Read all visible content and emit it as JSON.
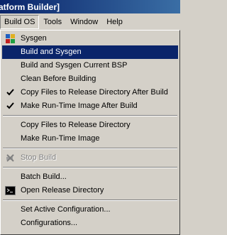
{
  "window": {
    "title_fragment": "atform Builder]"
  },
  "menubar": {
    "items": [
      {
        "label": "Build OS",
        "open": true
      },
      {
        "label": "Tools"
      },
      {
        "label": "Window"
      },
      {
        "label": "Help"
      }
    ]
  },
  "menu": {
    "sysgen": "Sysgen",
    "build_and_sysgen": "Build and Sysgen",
    "build_and_sysgen_bsp": "Build and Sysgen Current BSP",
    "clean_before_building": "Clean Before Building",
    "copy_files_after_build": "Copy Files to Release Directory After Build",
    "make_runtime_after_build": "Make Run-Time Image After Build",
    "copy_files_to_release": "Copy Files to Release Directory",
    "make_runtime_image": "Make Run-Time Image",
    "stop_build": "Stop Build",
    "batch_build": "Batch Build...",
    "open_release_dir": "Open Release Directory",
    "set_active_config": "Set Active Configuration...",
    "configurations": "Configurations..."
  },
  "state": {
    "selected_item": "Build and Sysgen",
    "checked": [
      "Copy Files to Release Directory After Build",
      "Make Run-Time Image After Build"
    ],
    "disabled": [
      "Stop Build"
    ]
  },
  "icons": {
    "sysgen": "sysgen-blocks-icon",
    "check": "check-icon",
    "stop": "stop-build-icon",
    "console": "console-icon"
  },
  "colors": {
    "highlight": "#0a246a",
    "menu_bg": "#d4d0c8",
    "disabled_text": "#808080"
  }
}
